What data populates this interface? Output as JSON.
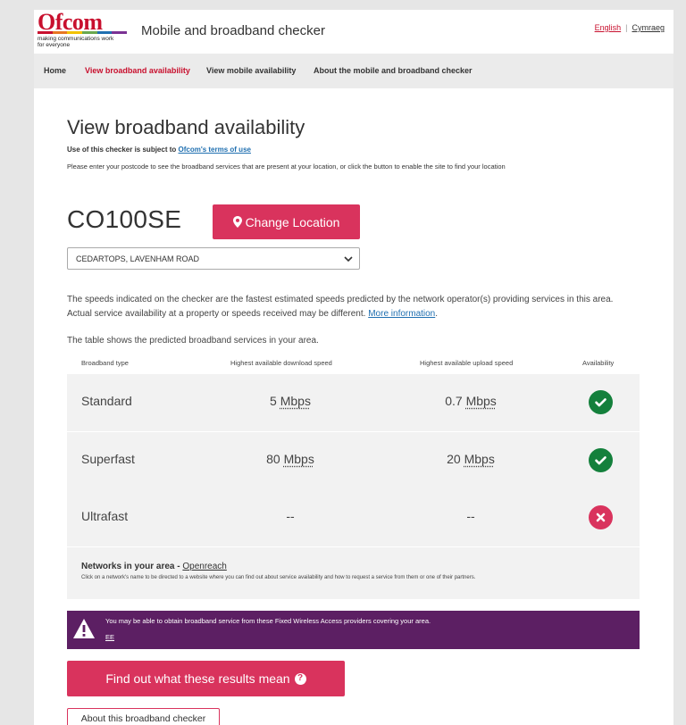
{
  "header": {
    "logo_text": "Ofcom",
    "logo_tagline_1": "making communications work",
    "logo_tagline_2": "for everyone",
    "site_title": "Mobile and broadband checker",
    "lang_english": "English",
    "lang_cymraeg": "Cymraeg",
    "lang_separator": "|"
  },
  "nav": {
    "items": [
      {
        "label": "Home",
        "active": false
      },
      {
        "label": "View broadband availability",
        "active": true
      },
      {
        "label": "View mobile availability",
        "active": false
      },
      {
        "label": "About the mobile and broadband checker",
        "active": false
      }
    ]
  },
  "page": {
    "title": "View broadband availability",
    "terms_prefix": "Use of this checker is subject to ",
    "terms_link": "Ofcom's terms of use",
    "intro": "Please enter your postcode to see the broadband services that are present at your location, or click the button to enable the site to find your location"
  },
  "location": {
    "postcode": "CO100SE",
    "change_button": "Change Location",
    "selected_address": "CEDARTOPS, LAVENHAM ROAD"
  },
  "note": {
    "text": "The speeds indicated on the checker are the fastest estimated speeds predicted by the network operator(s) providing services in this area. Actual service availability at a property or speeds received may be different. ",
    "link": "More information",
    "suffix": "."
  },
  "table": {
    "caption": "The table shows the predicted broadband services in your area.",
    "headers": {
      "type": "Broadband type",
      "download": "Highest available download speed",
      "upload": "Highest available upload speed",
      "availability": "Availability"
    },
    "rows": [
      {
        "type": "Standard",
        "download": "5",
        "download_unit": "Mbps",
        "upload": "0.7",
        "upload_unit": "Mbps",
        "available": true
      },
      {
        "type": "Superfast",
        "download": "80",
        "download_unit": "Mbps",
        "upload": "20",
        "upload_unit": "Mbps",
        "available": true
      },
      {
        "type": "Ultrafast",
        "download": "--",
        "download_unit": "",
        "upload": "--",
        "upload_unit": "",
        "available": false
      }
    ]
  },
  "networks": {
    "label": "Networks in your area - ",
    "provider": "Openreach",
    "note": "Click on a network's name to be directed to a website where you can find out about service availability and how to request a service from them or one of their partners."
  },
  "fwa": {
    "text": "You may be able to obtain broadband service from these Fixed Wireless Access providers covering your area.",
    "provider": "EE"
  },
  "buttons": {
    "results": "Find out what these results mean",
    "about": "About this broadband checker"
  },
  "colors": {
    "brand_red": "#c8102e",
    "button_pink": "#d9335d",
    "available_green": "#14803c",
    "banner_purple": "#5c1f63",
    "link_blue": "#1f6fb0"
  }
}
